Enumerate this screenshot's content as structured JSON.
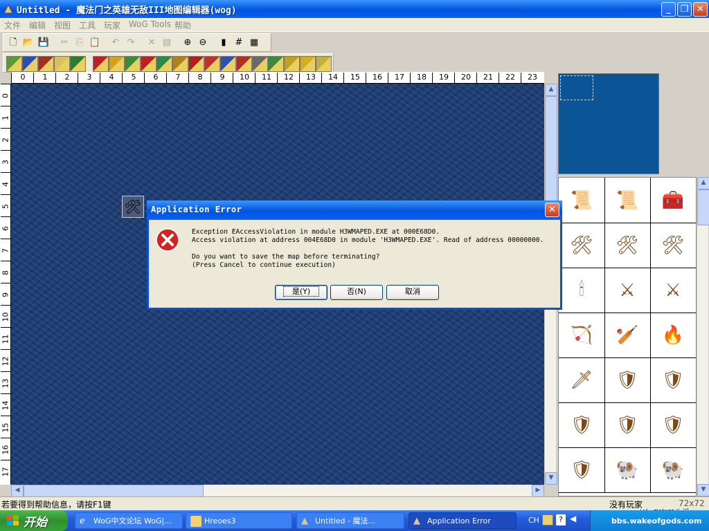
{
  "window": {
    "title": "Untitled - 魔法门之英雄无敌III地图编辑器(wog)",
    "minimize": "_",
    "maximize": "❐",
    "close": "✕"
  },
  "menu": [
    "文件",
    "编辑",
    "视图",
    "工具",
    "玩家",
    "WoG Tools",
    "帮助"
  ],
  "toolbar1": [
    {
      "glyph": "🗋",
      "icon": "new-icon",
      "disabled": false
    },
    {
      "glyph": "📂",
      "icon": "open-icon",
      "disabled": false
    },
    {
      "glyph": "💾",
      "icon": "save-icon",
      "disabled": false
    },
    {
      "glyph": "✂",
      "icon": "cut-icon",
      "disabled": true
    },
    {
      "glyph": "⎘",
      "icon": "copy-icon",
      "disabled": true
    },
    {
      "glyph": "📋",
      "icon": "paste-icon",
      "disabled": true
    },
    {
      "glyph": "↶",
      "icon": "undo-icon",
      "disabled": true
    },
    {
      "glyph": "↷",
      "icon": "redo-icon",
      "disabled": true
    },
    {
      "glyph": "✕",
      "icon": "delete-icon",
      "disabled": true
    },
    {
      "glyph": "▤",
      "icon": "properties-icon",
      "disabled": true
    },
    {
      "glyph": "⊕",
      "icon": "zoom-in-icon",
      "disabled": false
    },
    {
      "glyph": "⊖",
      "icon": "zoom-out-icon",
      "disabled": false
    },
    {
      "glyph": "▮",
      "icon": "view-underground-icon",
      "disabled": false
    },
    {
      "glyph": "#",
      "icon": "grid-icon",
      "disabled": false
    },
    {
      "glyph": "▦",
      "icon": "passability-icon",
      "disabled": false
    }
  ],
  "toolbar2": [
    {
      "icon": "terrain-icon",
      "color": "#5a9a3a"
    },
    {
      "icon": "road-icon",
      "color": "#2a4fb0"
    },
    {
      "icon": "river-icon",
      "color": "#a03020"
    },
    {
      "icon": "eraser-icon",
      "color": "#d8c060"
    },
    {
      "icon": "tree-icon",
      "color": "#2e7a2e"
    },
    {
      "icon": "monster-icon",
      "color": "#c02020"
    },
    {
      "icon": "artifact-icon",
      "color": "#d0a020"
    },
    {
      "icon": "resource-icon",
      "color": "#3a8a3a"
    },
    {
      "icon": "hero-icon",
      "color": "#c02020"
    },
    {
      "icon": "town-icon",
      "color": "#2a8a4a"
    },
    {
      "icon": "mine-icon",
      "color": "#b08020"
    },
    {
      "icon": "dwelling-icon",
      "color": "#b02020"
    },
    {
      "icon": "building-icon",
      "color": "#c03030"
    },
    {
      "icon": "obstacle-icon",
      "color": "#3050b0"
    },
    {
      "icon": "quest-icon",
      "color": "#b03020"
    },
    {
      "icon": "house-icon",
      "color": "#6a6a6a"
    },
    {
      "icon": "goblin-icon",
      "color": "#3a8a3a"
    },
    {
      "icon": "tower-icon",
      "color": "#c0a020"
    },
    {
      "icon": "trophy-icon",
      "color": "#d0b020"
    },
    {
      "icon": "crown-icon",
      "color": "#c0b040"
    }
  ],
  "ruler_h": [
    "0",
    "1",
    "2",
    "3",
    "4",
    "5",
    "6",
    "7",
    "8",
    "9",
    "10",
    "11",
    "12",
    "13",
    "14",
    "15",
    "16",
    "17",
    "18",
    "19",
    "20",
    "21",
    "22",
    "23"
  ],
  "ruler_v": [
    "0",
    "1",
    "2",
    "3",
    "4",
    "5",
    "6",
    "7",
    "8",
    "9",
    "10",
    "11",
    "12",
    "13",
    "14",
    "15",
    "16",
    "17"
  ],
  "objects": [
    "📜",
    "📜",
    "🧰",
    "🛠",
    "🛠",
    "🛠",
    "🕯",
    "⚔",
    "⚔",
    "🏹",
    "🏏",
    "🔥",
    "🗡",
    "🛡",
    "🛡",
    "🛡",
    "🛡",
    "🛡",
    "🛡",
    "🐏",
    "🐏"
  ],
  "status": {
    "help": "若要得到帮助信息，请按F1键",
    "players": "没有玩家",
    "size": "72x72",
    "watermark": "WoG中文论坛",
    "url": "bbs.wakeofgods.com"
  },
  "dialog": {
    "title": "Application Error",
    "line1": "Exception EAccessViolation in module H3WMAPED.EXE at 000E68D0.",
    "line2": "Access violation at address 004E68D0 in module 'H3WMAPED.EXE'. Read of address 00000000.",
    "line3": "Do you want to save the map before terminating?",
    "line4": "(Press Cancel to continue execution)",
    "yes": "是(Y)",
    "no": "否(N)",
    "cancel": "取消",
    "close": "✕"
  },
  "taskbar": {
    "start": "开始",
    "tasks": [
      {
        "label": "WoG中文论坛 WoG|...",
        "active": false
      },
      {
        "label": "Hreoes3",
        "active": false
      },
      {
        "label": "Untitled - 魔法...",
        "active": false
      },
      {
        "label": "Application Error",
        "active": true
      }
    ],
    "lang": "CH"
  }
}
